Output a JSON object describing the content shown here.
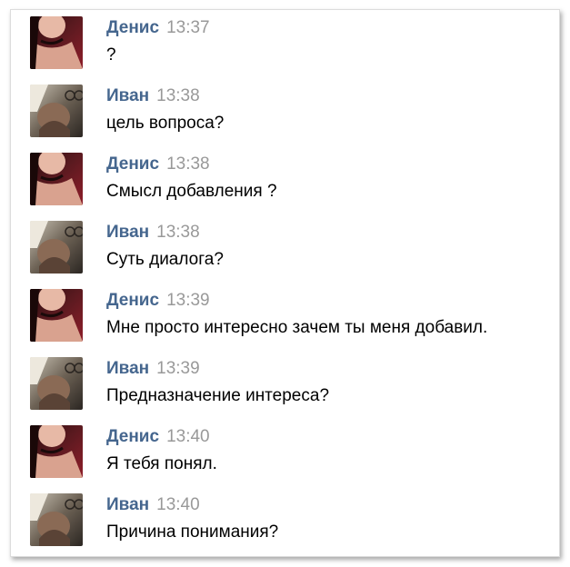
{
  "colors": {
    "name": "#45668e",
    "time": "#999999",
    "text": "#000000"
  },
  "messages": [
    {
      "author": "Денис",
      "time": "13:37",
      "text": "?",
      "avatar": "denis-avatar"
    },
    {
      "author": "Иван",
      "time": "13:38",
      "text": "цель вопроса?",
      "avatar": "ivan-avatar"
    },
    {
      "author": "Денис",
      "time": "13:38",
      "text": "Смысл добавления ?",
      "avatar": "denis-avatar"
    },
    {
      "author": "Иван",
      "time": "13:38",
      "text": "Суть диалога?",
      "avatar": "ivan-avatar"
    },
    {
      "author": "Денис",
      "time": "13:39",
      "text": "Мне просто интересно зачем ты меня добавил.",
      "avatar": "denis-avatar"
    },
    {
      "author": "Иван",
      "time": "13:39",
      "text": "Предназначение интереса?",
      "avatar": "ivan-avatar"
    },
    {
      "author": "Денис",
      "time": "13:40",
      "text": "Я тебя понял.",
      "avatar": "denis-avatar"
    },
    {
      "author": "Иван",
      "time": "13:40",
      "text": "Причина понимания?",
      "avatar": "ivan-avatar"
    }
  ]
}
